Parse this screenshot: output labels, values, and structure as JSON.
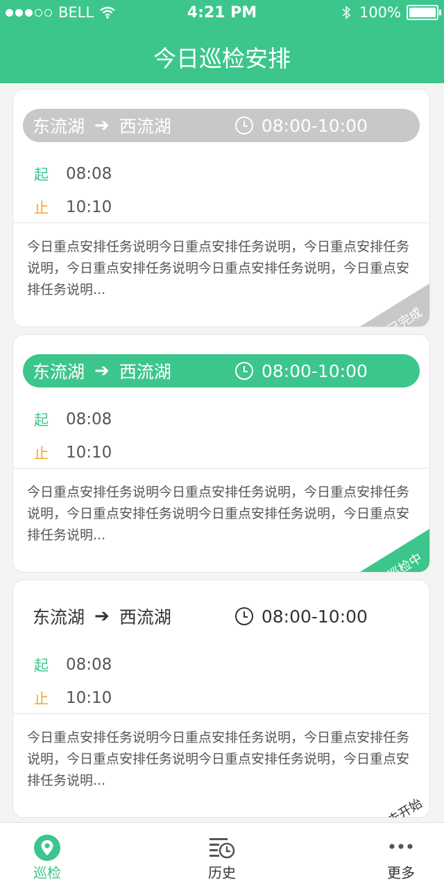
{
  "status": {
    "carrier": "BELL",
    "time": "4:21 PM",
    "battery": "100%"
  },
  "header": {
    "title": "今日巡检安排"
  },
  "cards": [
    {
      "status": "done",
      "from": "东流湖",
      "to": "西流湖",
      "time_range": "08:00-10:00",
      "start_label": "起",
      "start_time": "08:08",
      "end_label": "止",
      "end_time": "10:10",
      "description": "今日重点安排任务说明今日重点安排任务说明，今日重点安排任务说明，今日重点安排任务说明今日重点安排任务说明，今日重点安排任务说明...",
      "badge": "已完成"
    },
    {
      "status": "active",
      "from": "东流湖",
      "to": "西流湖",
      "time_range": "08:00-10:00",
      "start_label": "起",
      "start_time": "08:08",
      "end_label": "止",
      "end_time": "10:10",
      "description": "今日重点安排任务说明今日重点安排任务说明，今日重点安排任务说明，今日重点安排任务说明今日重点安排任务说明，今日重点安排任务说明...",
      "badge": "巡检中"
    },
    {
      "status": "pending",
      "from": "东流湖",
      "to": "西流湖",
      "time_range": "08:00-10:00",
      "start_label": "起",
      "start_time": "08:08",
      "end_label": "止",
      "end_time": "10:10",
      "description": "今日重点安排任务说明今日重点安排任务说明，今日重点安排任务说明，今日重点安排任务说明今日重点安排任务说明，今日重点安排任务说明...",
      "badge": "未开始"
    }
  ],
  "tabs": [
    {
      "label": "巡检",
      "icon": "location-icon",
      "active": true
    },
    {
      "label": "历史",
      "icon": "history-icon",
      "active": false
    },
    {
      "label": "更多",
      "icon": "more-icon",
      "active": false
    }
  ],
  "colors": {
    "primary": "#3cc68c",
    "done": "#c8c8c8",
    "end": "#f5a623"
  }
}
